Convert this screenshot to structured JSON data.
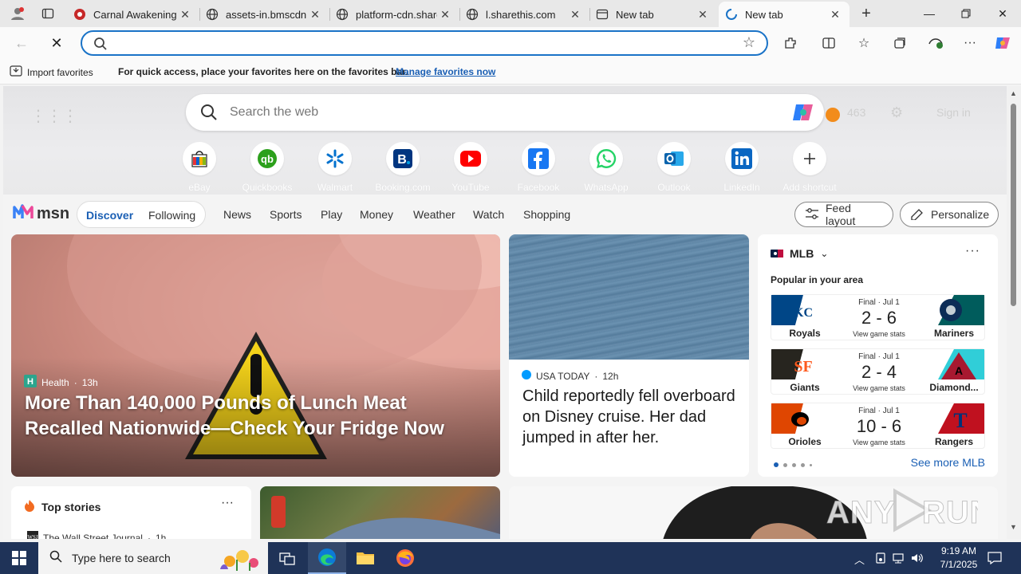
{
  "browser": {
    "tabs": [
      {
        "title": "Carnal Awakening (",
        "favicon": "red-circle-icon",
        "active": false
      },
      {
        "title": "assets-in.bmscdn.c",
        "favicon": "globe-icon",
        "active": false
      },
      {
        "title": "platform-cdn.share",
        "favicon": "globe-icon",
        "active": false
      },
      {
        "title": "l.sharethis.com",
        "favicon": "globe-icon",
        "active": false
      },
      {
        "title": "New tab",
        "favicon": "newtab-icon",
        "active": false
      },
      {
        "title": "New tab",
        "favicon": "loading-icon",
        "active": true
      }
    ],
    "address": {
      "value": "",
      "placeholder": ""
    },
    "favorites_bar": {
      "import_label": "Import favorites",
      "message": "For quick access, place your favorites here on the favorites bar.",
      "manage_link": "Manage favorites now"
    }
  },
  "newtab": {
    "search_placeholder": "Search the web",
    "rewards_points": "463",
    "sign_in": "Sign in",
    "shortcuts": [
      {
        "label": "eBay",
        "icon": "ebay-bag-icon"
      },
      {
        "label": "Quickbooks",
        "icon": "quickbooks-icon"
      },
      {
        "label": "Walmart",
        "icon": "walmart-spark-icon"
      },
      {
        "label": "Booking.com",
        "icon": "booking-icon"
      },
      {
        "label": "YouTube",
        "icon": "youtube-icon"
      },
      {
        "label": "Facebook",
        "icon": "facebook-icon"
      },
      {
        "label": "WhatsApp",
        "icon": "whatsapp-icon"
      },
      {
        "label": "Outlook",
        "icon": "outlook-icon"
      },
      {
        "label": "LinkedIn",
        "icon": "linkedin-icon"
      },
      {
        "label": "Add shortcut",
        "icon": "plus-icon"
      }
    ]
  },
  "msn": {
    "logo": "msn",
    "pill": {
      "discover": "Discover",
      "following": "Following"
    },
    "nav": [
      "News",
      "Sports",
      "Play",
      "Money",
      "Weather",
      "Watch",
      "Shopping"
    ],
    "feed_layout": "Feed layout",
    "personalize": "Personalize"
  },
  "cards": {
    "big": {
      "source": "Health",
      "age": "13h",
      "headline": "More Than 140,000 Pounds of Lunch Meat Recalled Nationwide—Check Your Fridge Now"
    },
    "sea": {
      "source": "USA TODAY",
      "age": "12h",
      "headline": "Child reportedly fell overboard on Disney cruise. Her dad jumped in after her."
    },
    "mlb": {
      "title": "MLB",
      "subtitle": "Popular in your area",
      "see_more": "See more MLB",
      "games": [
        {
          "status": "Final · Jul 1",
          "score": "2 - 6",
          "stats": "View game stats",
          "home": "Royals",
          "away": "Mariners"
        },
        {
          "status": "Final · Jul 1",
          "score": "2 - 4",
          "stats": "View game stats",
          "home": "Giants",
          "away": "Diamond..."
        },
        {
          "status": "Final · Jul 1",
          "score": "10 - 6",
          "stats": "View game stats",
          "home": "Orioles",
          "away": "Rangers"
        }
      ]
    },
    "top_stories": {
      "title": "Top stories",
      "source": "The Wall Street Journal",
      "age": "1h"
    }
  },
  "watermark": "ANY RUN",
  "taskbar": {
    "search_placeholder": "Type here to search",
    "time": "9:19 AM",
    "date": "7/1/2025"
  },
  "colors": {
    "accent": "#1a5fb4",
    "address_border": "#1a73c7",
    "taskbar": "#1f3358"
  }
}
